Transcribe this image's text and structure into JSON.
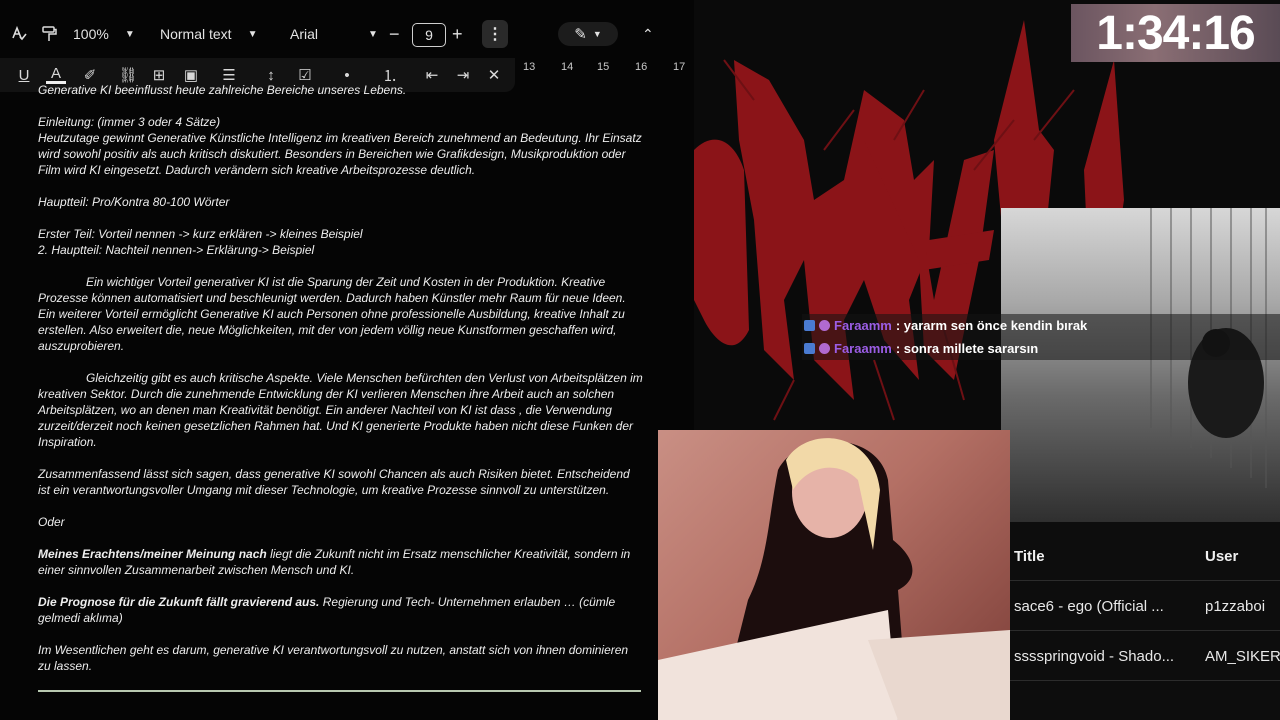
{
  "toolbar": {
    "zoom": "100%",
    "style": "Normal text",
    "font": "Arial",
    "font_size": "9",
    "minus": "−",
    "plus": "+"
  },
  "ruler": [
    "13",
    "14",
    "15",
    "16",
    "17"
  ],
  "doc": {
    "lines": [
      "Generative KI beeinflusst heute zahlreiche Bereiche unseres Lebens.",
      "",
      "Einleitung: (immer 3 oder 4 Sätze)",
      "Heutzutage gewinnt Generative Künstliche Intelligenz im kreativen Bereich zunehmend an Bedeutung. Ihr Einsatz wird sowohl positiv als auch kritisch diskutiert. Besonders in Bereichen wie Grafikdesign, Musikproduktion oder Film wird KI eingesetzt. Dadurch verändern sich kreative Arbeitsprozesse deutlich.",
      "",
      "Hauptteil: Pro/Kontra 80-100 Wörter",
      "",
      "Erster Teil: Vorteil nennen -> kurz erklären -> kleines Beispiel",
      "2. Hauptteil: Nachteil nennen-> Erklärung-> Beispiel",
      "",
      "Ein wichtiger Vorteil generativer KI ist die Sparung der Zeit und Kosten in der Produktion. Kreative Prozesse können automatisiert und beschleunigt werden. Dadurch haben Künstler mehr Raum für neue Ideen. Ein weiterer Vorteil ermöglicht Generative KI auch Personen ohne professionelle Ausbildung, kreative Inhalt zu erstellen. Also erweitert die, neue Möglichkeiten, mit der von jedem völlig neue Kunstformen geschaffen wird, auszuprobieren.",
      "",
      "Gleichzeitig gibt es auch kritische Aspekte. Viele Menschen befürchten den Verlust von Arbeitsplätzen im kreativen Sektor. Durch die zunehmende Entwicklung der KI verlieren Menschen ihre Arbeit auch an solchen Arbeitsplätzen, wo an denen man Kreativität benötigt. Ein anderer Nachteil von KI ist dass , die Verwendung zurzeit/derzeit noch keinen gesetzlichen Rahmen hat. Und KI generierte Produkte haben nicht diese Funken der Inspiration.",
      "",
      "Zusammenfassend lässt sich sagen, dass generative KI sowohl Chancen als auch Risiken bietet. Entscheidend ist ein verantwortungsvoller Umgang mit dieser Technologie, um kreative Prozesse sinnvoll zu unterstützen.",
      "",
      "Oder",
      "",
      "",
      "",
      "",
      "",
      "Im Wesentlichen geht es darum, generative KI verantwortungsvoll zu nutzen, anstatt sich von ihnen dominieren zu lassen."
    ],
    "bold1": "Meines Erachtens/meiner Meinung nach",
    "rest1": " liegt die Zukunft nicht im Ersatz menschlicher Kreativität, sondern in einer sinnvollen Zusammenarbeit zwischen Mensch und KI.",
    "bold2": "Die Prognose für die Zukunft fällt gravierend aus.",
    "rest2": " Regierung und Tech- Unternehmen erlauben … (cümle gelmedi aklıma)"
  },
  "timer": "1:34:16",
  "chat": [
    {
      "user": "Faraamm",
      "text": " : yararm sen önce kendin bırak"
    },
    {
      "user": "Faraamm",
      "text": " : sonra millete sararsın"
    }
  ],
  "songs": {
    "headers": [
      "Title",
      "User"
    ],
    "rows": [
      [
        "sace6 - ego (Official ...",
        "p1zzaboi"
      ],
      [
        "sssspringvoid - Shado...",
        "AM_SIKER_"
      ]
    ]
  },
  "colors": {
    "chat_user": "#9b5de5",
    "logo_red": "#8b1418"
  }
}
